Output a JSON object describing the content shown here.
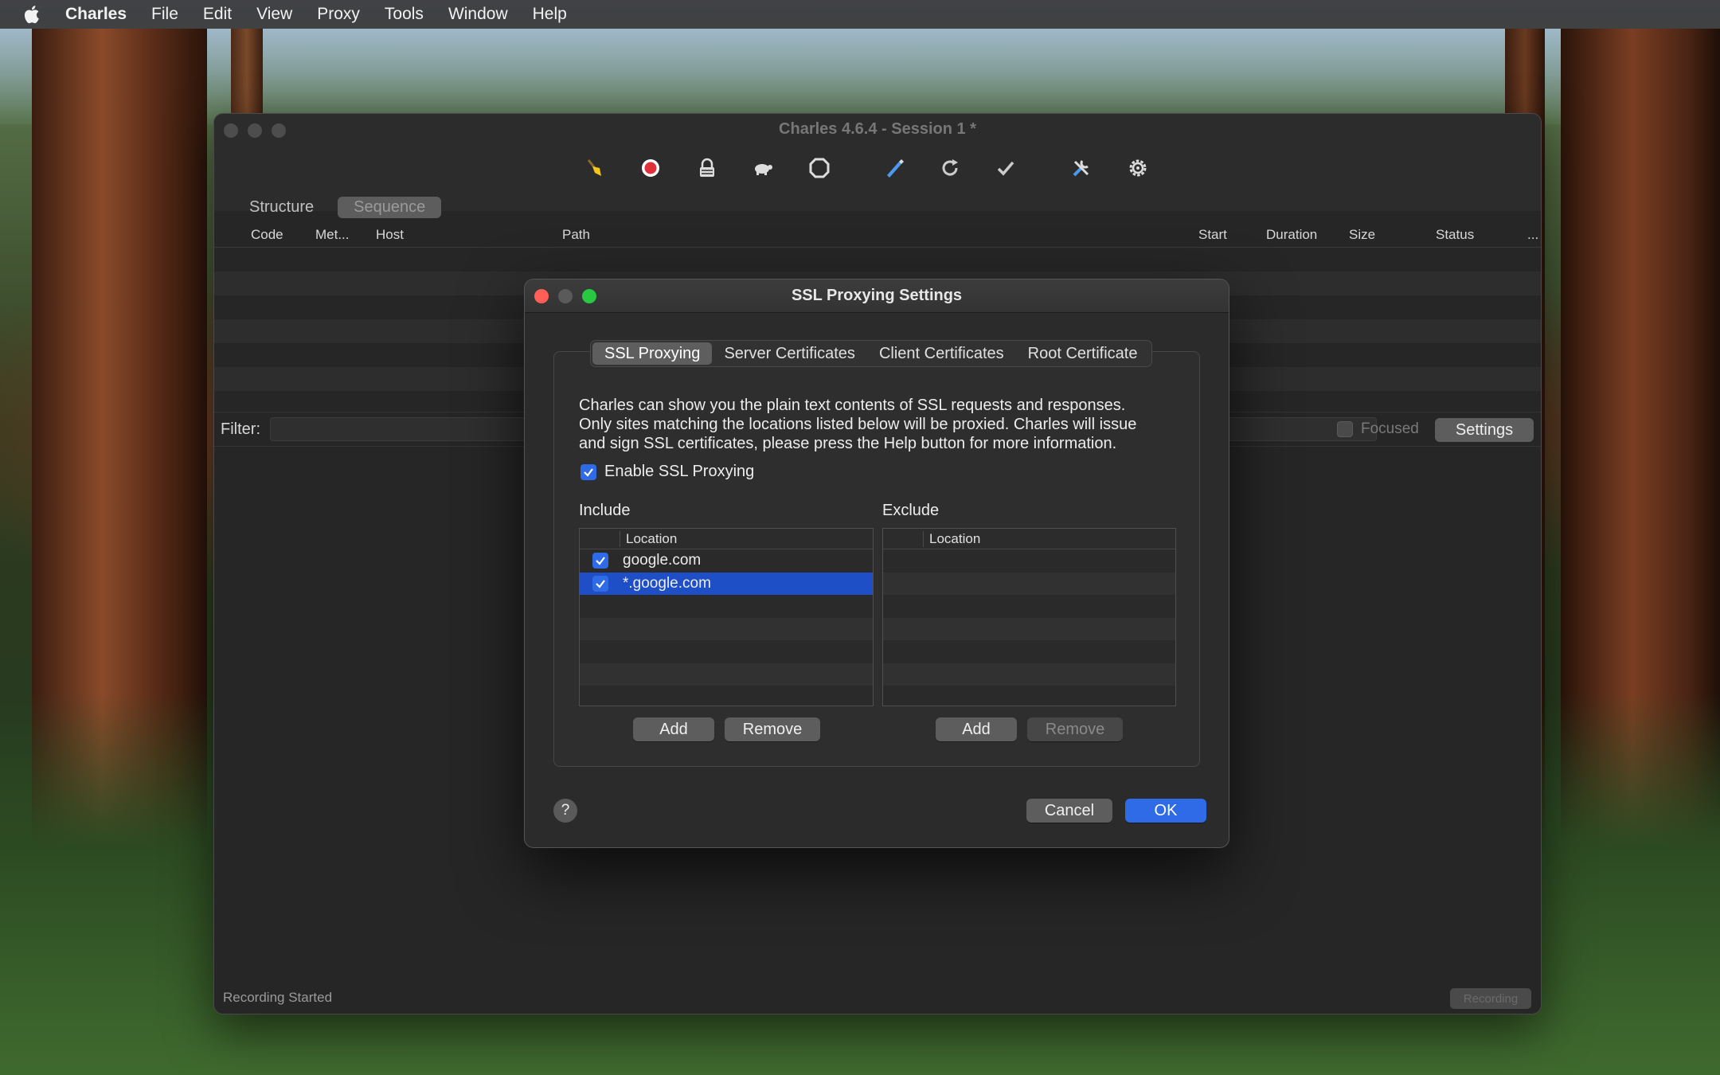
{
  "menubar": {
    "app": "Charles",
    "items": [
      "File",
      "Edit",
      "View",
      "Proxy",
      "Tools",
      "Window",
      "Help"
    ]
  },
  "main_window": {
    "title": "Charles 4.6.4 - Session 1 *",
    "toolbar_icons": [
      "broom-icon",
      "record-icon",
      "ssl-lock-icon",
      "throttle-turtle-icon",
      "breakpoint-stop-icon",
      "compose-pen-icon",
      "repeat-icon",
      "validate-check-icon",
      "tools-icon",
      "settings-gear-icon"
    ],
    "view_tabs": [
      {
        "label": "Structure",
        "active": false
      },
      {
        "label": "Sequence",
        "active": true
      }
    ],
    "columns": [
      "Code",
      "Met...",
      "Host",
      "Path",
      "Start",
      "Duration",
      "Size",
      "Status",
      "..."
    ],
    "filter_label": "Filter:",
    "focused_label": "Focused",
    "settings_label": "Settings",
    "status_text": "Recording Started",
    "recording_label": "Recording"
  },
  "dialog": {
    "title": "SSL Proxying Settings",
    "tabs": [
      {
        "label": "SSL Proxying",
        "active": true
      },
      {
        "label": "Server Certificates",
        "active": false
      },
      {
        "label": "Client Certificates",
        "active": false
      },
      {
        "label": "Root Certificate",
        "active": false
      }
    ],
    "description_lines": [
      "Charles can show you the plain text contents of SSL requests and responses.",
      "Only sites matching the locations listed below will be proxied. Charles will issue",
      "and sign SSL certificates, please press the Help button for more information."
    ],
    "enable_label": "Enable SSL Proxying",
    "enable_checked": true,
    "include": {
      "label": "Include",
      "column": "Location",
      "rows": [
        {
          "location": "google.com",
          "checked": true,
          "selected": false
        },
        {
          "location": "*.google.com",
          "checked": true,
          "selected": true
        }
      ],
      "add_label": "Add",
      "remove_label": "Remove"
    },
    "exclude": {
      "label": "Exclude",
      "column": "Location",
      "rows": [],
      "add_label": "Add",
      "remove_label": "Remove"
    },
    "help_label": "?",
    "cancel_label": "Cancel",
    "ok_label": "OK"
  },
  "colors": {
    "accent": "#2f6be6",
    "selection": "#1f4fc7",
    "record_red": "#e0303a",
    "broom_yellow": "#f5c518",
    "pen_blue": "#4a9af0"
  }
}
